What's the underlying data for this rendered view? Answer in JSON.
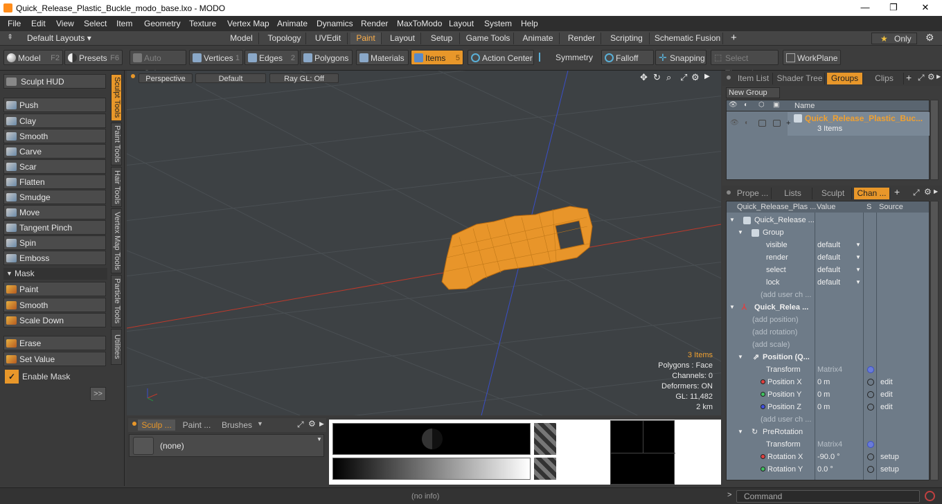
{
  "window": {
    "title": "Quick_Release_Plastic_Buckle_modo_base.lxo - MODO",
    "minimize": "—",
    "maximize": "❐",
    "close": "✕"
  },
  "menu": [
    "File",
    "Edit",
    "View",
    "Select",
    "Item",
    "Geometry",
    "Texture",
    "Vertex Map",
    "Animate",
    "Dynamics",
    "Render",
    "MaxToModo",
    "Layout",
    "System",
    "Help"
  ],
  "layoutbar": {
    "preset": "Default Layouts ▾",
    "tabs": [
      "Model",
      "Topology",
      "UVEdit",
      "Paint",
      "Layout",
      "Setup",
      "Game Tools",
      "Animate",
      "Render",
      "Scripting",
      "Schematic Fusion"
    ],
    "active_tab": "Paint",
    "add": "+",
    "only": "Only"
  },
  "toolbar": {
    "model": "Model",
    "model_key": "F2",
    "presets": "Presets",
    "presets_key": "F6",
    "auto_select": "Auto Select",
    "vertices": "Vertices",
    "vertices_key": "1",
    "edges": "Edges",
    "edges_key": "2",
    "polygons": "Polygons",
    "materials": "Materials",
    "items": "Items",
    "items_key": "5",
    "action_center": "Action Center",
    "symmetry": "Symmetry",
    "falloff": "Falloff",
    "snapping": "Snapping",
    "select_through": "Select Through",
    "workplane": "WorkPlane"
  },
  "left": {
    "sculpt_hud": "Sculpt HUD",
    "tools": [
      "Push",
      "Clay",
      "Smooth",
      "Carve",
      "Scar",
      "Flatten",
      "Smudge",
      "Move",
      "Tangent Pinch",
      "Spin",
      "Emboss"
    ],
    "mask_header": "Mask",
    "mask_tools": [
      "Paint",
      "Smooth",
      "Scale Down"
    ],
    "erase": "Erase",
    "set_value": "Set Value",
    "enable_mask": "Enable Mask",
    "expand": ">>",
    "vtabs": [
      "Sculpt Tools",
      "Paint Tools",
      "Hair Tools",
      "Vertex Map Tools",
      "Particle Tools",
      "Utilities"
    ]
  },
  "viewport": {
    "perspective": "Perspective",
    "default": "Default",
    "raygl": "Ray GL: Off",
    "info": {
      "items": "3 Items",
      "polygons": "Polygons : Face",
      "channels": "Channels: 0",
      "deformers": "Deformers: ON",
      "gl": "GL: 11,482",
      "scale": "2 km"
    },
    "colors": {
      "model": "#f0a030",
      "x_axis": "#c0392b",
      "y_axis": "#3a4fc8"
    }
  },
  "bottom": {
    "tabs": [
      "Sculp ...",
      "Paint ...",
      "Brushes"
    ],
    "preset_value": "(none)"
  },
  "status": {
    "info": "(no info)",
    "command_placeholder": "Command"
  },
  "right": {
    "top_tabs": [
      "Item List",
      "Shader Tree",
      "Groups",
      "Clips"
    ],
    "active_top": "Groups",
    "new_group": "New Group",
    "name_header": "Name",
    "group_name": "Quick_Release_Plastic_Buc...",
    "group_count": "3 Items",
    "bottom_tabs": [
      "Prope ...",
      "Lists",
      "Sculpt",
      "Chan ..."
    ],
    "active_bottom": "Chan ...",
    "chan_headers": [
      "Quick_Release_Plas ...",
      "Value",
      "S",
      "Source"
    ],
    "rows": [
      {
        "label": "Quick_Release ...",
        "value": "",
        "source": ""
      },
      {
        "label": "Group",
        "value": "",
        "source": ""
      },
      {
        "label": "visible",
        "value": "default",
        "source": ""
      },
      {
        "label": "render",
        "value": "default",
        "source": ""
      },
      {
        "label": "select",
        "value": "default",
        "source": ""
      },
      {
        "label": "lock",
        "value": "default",
        "source": ""
      },
      {
        "label": "(add user ch ...",
        "value": "",
        "source": ""
      },
      {
        "label": "Quick_Relea ...",
        "value": "",
        "source": ""
      },
      {
        "label": "(add position)",
        "value": "",
        "source": ""
      },
      {
        "label": "(add rotation)",
        "value": "",
        "source": ""
      },
      {
        "label": "(add scale)",
        "value": "",
        "source": ""
      },
      {
        "label": "Position (Q...",
        "value": "",
        "source": ""
      },
      {
        "label": "Transform",
        "value": "Matrix4",
        "source": ""
      },
      {
        "label": "Position X",
        "value": "0 m",
        "source": "edit"
      },
      {
        "label": "Position Y",
        "value": "0 m",
        "source": "edit"
      },
      {
        "label": "Position Z",
        "value": "0 m",
        "source": "edit"
      },
      {
        "label": "(add user ch ...",
        "value": "",
        "source": ""
      },
      {
        "label": "PreRotation",
        "value": "",
        "source": ""
      },
      {
        "label": "Transform",
        "value": "Matrix4",
        "source": ""
      },
      {
        "label": "Rotation X",
        "value": "-90.0 °",
        "source": "setup"
      },
      {
        "label": "Rotation Y",
        "value": "0.0 °",
        "source": "setup"
      }
    ]
  }
}
